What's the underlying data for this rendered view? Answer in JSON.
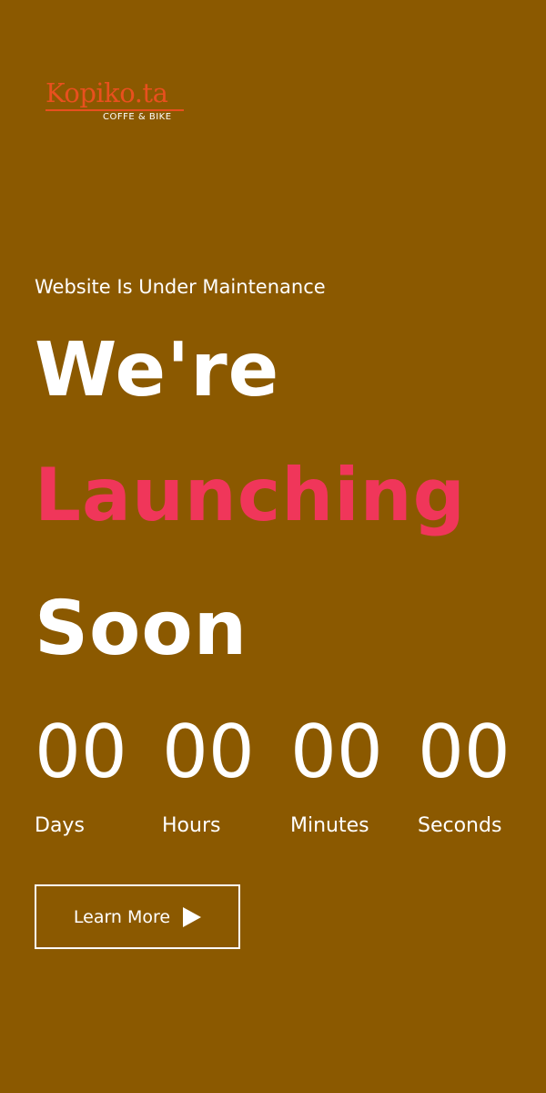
{
  "brand": {
    "name": "Kopiko.ta",
    "tagline": "COFFE & BIKE",
    "color": "#E8501E"
  },
  "hero": {
    "subtitle": "Website Is Under Maintenance",
    "line1": "We're",
    "line2": "Launching",
    "line3": "Soon",
    "accent_color": "#F0365A"
  },
  "countdown": {
    "days": {
      "value": "00",
      "label": "Days"
    },
    "hours": {
      "value": "00",
      "label": "Hours"
    },
    "minutes": {
      "value": "00",
      "label": "Minutes"
    },
    "seconds": {
      "value": "00",
      "label": "Seconds"
    }
  },
  "cta": {
    "label": "Learn More",
    "icon": "play-icon"
  },
  "theme": {
    "background": "#8B5900",
    "text": "#FFFFFF"
  }
}
